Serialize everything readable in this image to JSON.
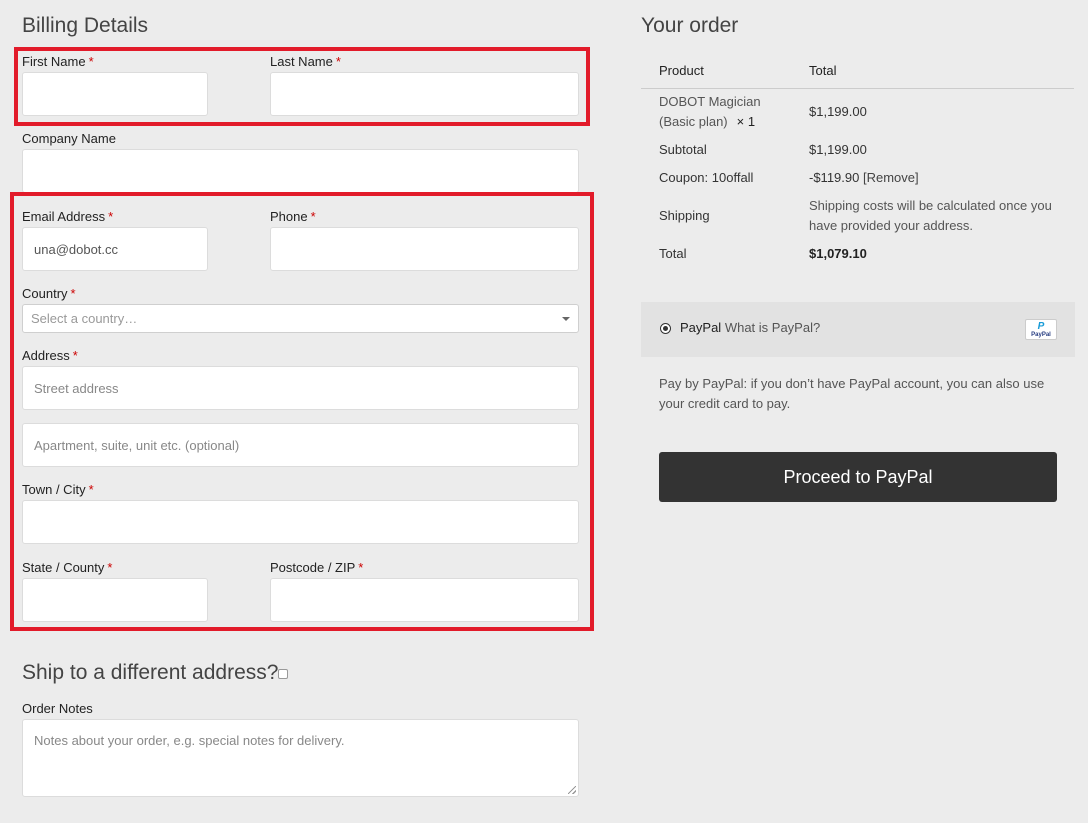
{
  "billing": {
    "title": "Billing Details",
    "required_mark": "*",
    "first_name": {
      "label": "First Name",
      "value": ""
    },
    "last_name": {
      "label": "Last Name",
      "value": ""
    },
    "company": {
      "label": "Company Name",
      "value": ""
    },
    "email": {
      "label": "Email Address",
      "value": "una@dobot.cc"
    },
    "phone": {
      "label": "Phone",
      "value": ""
    },
    "country": {
      "label": "Country",
      "placeholder": "Select a country…"
    },
    "address": {
      "label": "Address",
      "street_placeholder": "Street address",
      "apt_placeholder": "Apartment, suite, unit etc. (optional)"
    },
    "city": {
      "label": "Town / City",
      "value": ""
    },
    "state": {
      "label": "State / County",
      "value": ""
    },
    "postcode": {
      "label": "Postcode / ZIP",
      "value": ""
    }
  },
  "ship": {
    "title": "Ship to a different address?",
    "checked": false
  },
  "notes": {
    "label": "Order Notes",
    "placeholder": "Notes about your order, e.g. special notes for delivery."
  },
  "order": {
    "title": "Your order",
    "col_product": "Product",
    "col_total": "Total",
    "item_name_1": "DOBOT Magician",
    "item_name_2": "(Basic plan)",
    "item_qty": "× 1",
    "item_total": "$1,199.00",
    "subtotal_label": "Subtotal",
    "subtotal_value": "$1,199.00",
    "coupon_label": "Coupon: 10offall",
    "coupon_value": "-$119.90",
    "coupon_remove": "[Remove]",
    "shipping_label": "Shipping",
    "shipping_value_1": "Shipping costs will be calculated once you",
    "shipping_value_2": "have provided your address.",
    "total_label": "Total",
    "total_value": "$1,079.10"
  },
  "payment": {
    "method_name": "PayPal",
    "what_is": "What is PayPal?",
    "icon_text": "PayPal",
    "description_1": "Pay by PayPal: if you don’t have PayPal account, you can also use",
    "description_2": "your credit card to pay.",
    "button_label": "Proceed to PayPal"
  },
  "colors": {
    "highlight_border": "#e21b2a",
    "required": "#cc0000",
    "button_bg": "#333333",
    "page_bg": "#ececec"
  }
}
